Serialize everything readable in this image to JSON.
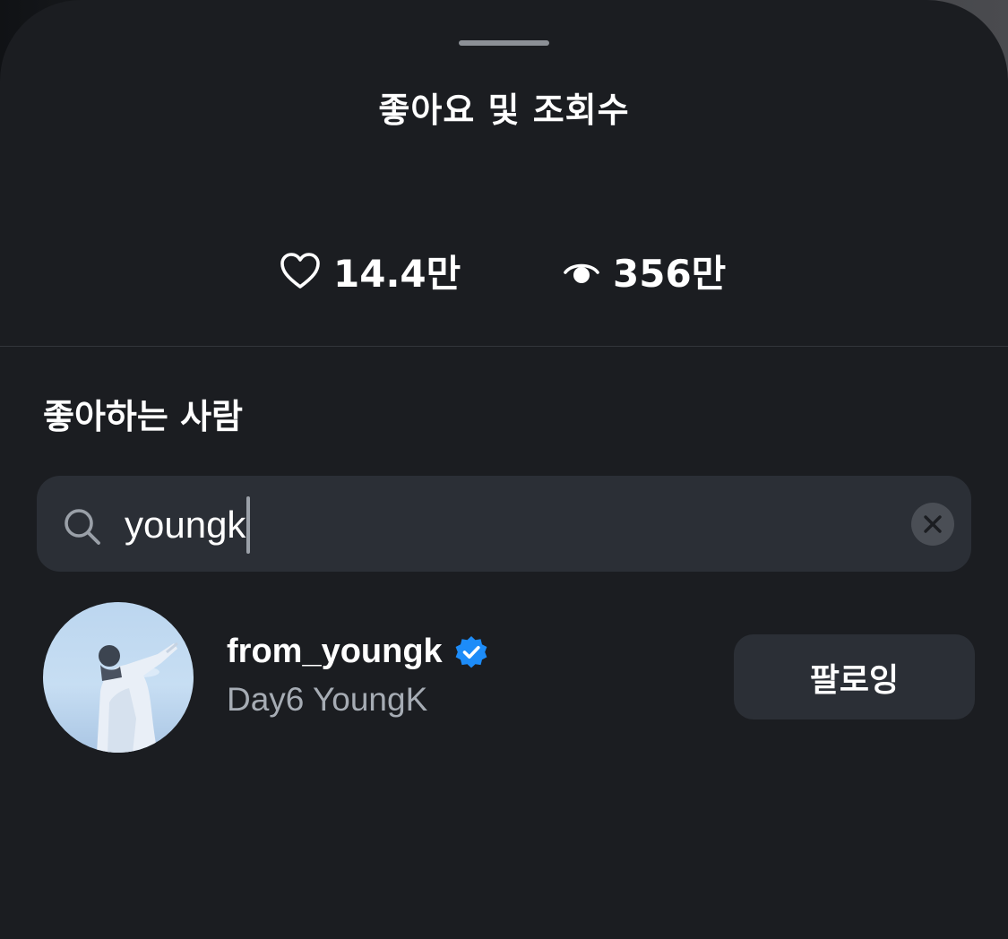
{
  "sheet": {
    "title": "좋아요 및 조회수"
  },
  "stats": {
    "likes": {
      "icon": "heart-icon",
      "value": "14.4만"
    },
    "views": {
      "icon": "eye-icon",
      "value": "356만"
    }
  },
  "likers": {
    "section_title": "좋아하는 사람",
    "search": {
      "value": "youngk",
      "icon": "search-icon",
      "clear_icon": "close-icon"
    },
    "results": [
      {
        "username": "from_youngk",
        "verified": true,
        "full_name": "Day6 YoungK",
        "follow_label": "팔로잉"
      }
    ]
  },
  "colors": {
    "background": "#1b1d21",
    "surface": "#2b2f36",
    "text_primary": "#ffffff",
    "text_secondary": "#a6acb4",
    "verified_blue": "#1d8cf8"
  }
}
